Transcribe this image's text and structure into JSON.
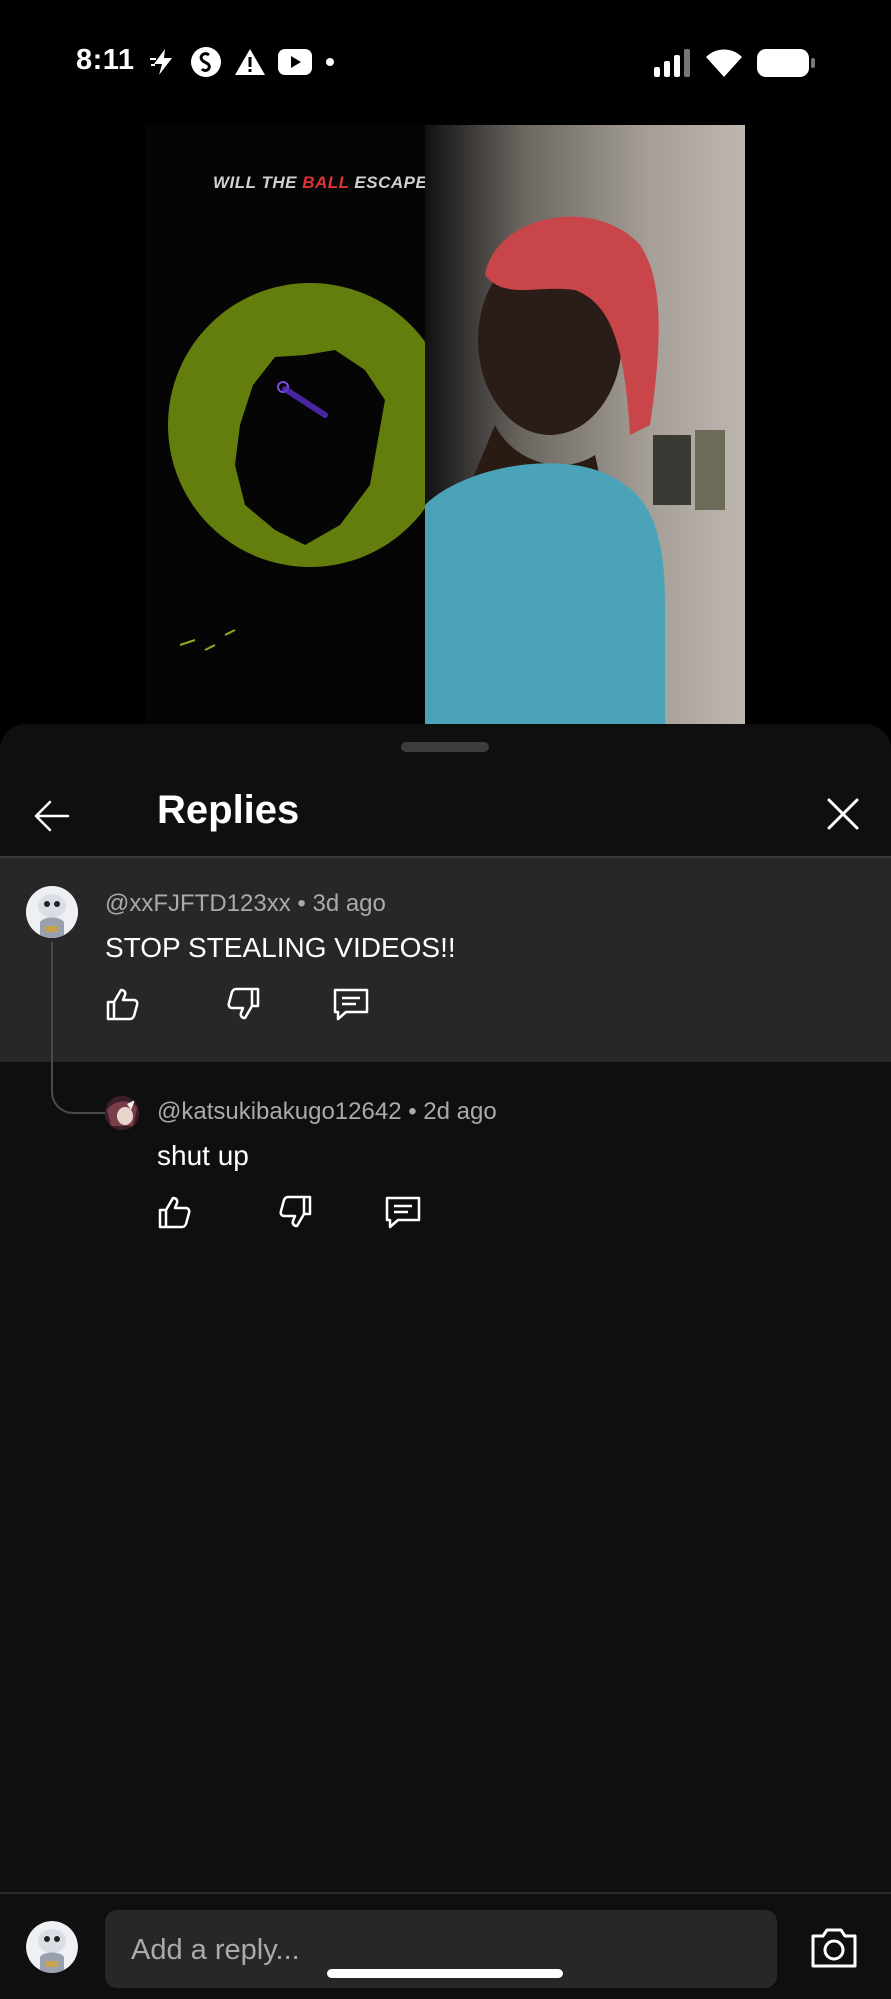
{
  "status_bar": {
    "time": "8:11",
    "left_icons": [
      "bolt-icon",
      "shazam-icon",
      "warning-icon",
      "youtube-icon",
      "dot-icon"
    ],
    "right_icons": [
      "signal-icon",
      "wifi-icon",
      "battery-icon"
    ]
  },
  "video": {
    "overlay_text_pre": "WILL THE ",
    "overlay_text_accent": "BALL",
    "overlay_text_post": " ESCAPE"
  },
  "panel": {
    "title": "Replies",
    "back_icon": "arrow-left-icon",
    "close_icon": "close-icon"
  },
  "comments": [
    {
      "author": "@xxFJFTD123xx",
      "age": "3d ago",
      "text": "STOP STEALING VIDEOS!!"
    },
    {
      "author": "@katsukibakugo12642",
      "age": "2d ago",
      "text": "shut up"
    }
  ],
  "separator": " • ",
  "reply_bar": {
    "placeholder": "Add a reply...",
    "camera_icon": "camera-icon"
  }
}
